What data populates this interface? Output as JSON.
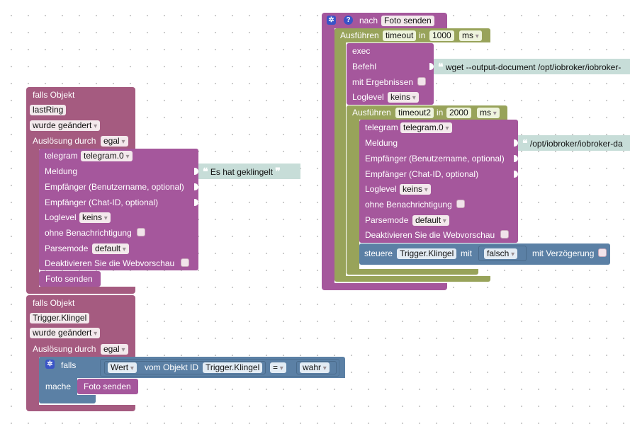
{
  "colors": {
    "event": "#a55b80",
    "telegram": "#a5579c",
    "timeout": "#98a35a",
    "logic": "#5b80a5",
    "string": "#c7ddd8",
    "field": "#f3e9ec"
  },
  "block1": {
    "title": "falls Objekt",
    "object": "lastRing",
    "changed": "wurde geändert",
    "trigger_label": "Auslösung durch",
    "trigger_value": "egal",
    "telegram": {
      "label": "telegram",
      "instance": "telegram.0",
      "message_label": "Meldung",
      "message_value": "Es hat geklingelt",
      "user_label": "Empfänger (Benutzername, optional)",
      "chat_label": "Empfänger (Chat-ID, optional)",
      "loglevel_label": "Loglevel",
      "loglevel_value": "keins",
      "silent_label": "ohne Benachrichtigung",
      "parsemode_label": "Parsemode",
      "parsemode_value": "default",
      "nopreview_label": "Deaktivieren Sie die Webvorschau"
    },
    "call_label": "Foto senden"
  },
  "block2": {
    "title": "falls Objekt",
    "object": "Trigger.Klingel",
    "changed": "wurde geändert",
    "trigger_label": "Auslösung durch",
    "trigger_value": "egal",
    "if_label": "falls",
    "value_label": "Wert",
    "from_object_label": "vom Objekt ID",
    "object_id": "Trigger.Klingel",
    "operator": "=",
    "compare_value": "wahr",
    "do_label": "mache",
    "call_label": "Foto senden"
  },
  "func": {
    "prefix": "nach",
    "name": "Foto senden",
    "timeout1": {
      "label": "Ausführen",
      "var": "timeout",
      "in_label": "in",
      "value": "1000",
      "unit": "ms"
    },
    "exec": {
      "label": "exec",
      "command_label": "Befehl",
      "command_value": "wget --output-document /opt/iobroker/iobroker-",
      "results_label": "mit Ergebnissen",
      "loglevel_label": "Loglevel",
      "loglevel_value": "keins"
    },
    "timeout2": {
      "label": "Ausführen",
      "var": "timeout2",
      "in_label": "in",
      "value": "2000",
      "unit": "ms"
    },
    "telegram": {
      "label": "telegram",
      "instance": "telegram.0",
      "message_label": "Meldung",
      "message_value": "/opt/iobroker/iobroker-da",
      "user_label": "Empfänger (Benutzername, optional)",
      "chat_label": "Empfänger (Chat-ID, optional)",
      "loglevel_label": "Loglevel",
      "loglevel_value": "keins",
      "silent_label": "ohne Benachrichtigung",
      "parsemode_label": "Parsemode",
      "parsemode_value": "default",
      "nopreview_label": "Deaktivieren Sie die Webvorschau"
    },
    "control": {
      "label": "steuere",
      "object": "Trigger.Klingel",
      "with_label": "mit",
      "value": "falsch",
      "delay_label": "mit Verzögerung"
    }
  }
}
